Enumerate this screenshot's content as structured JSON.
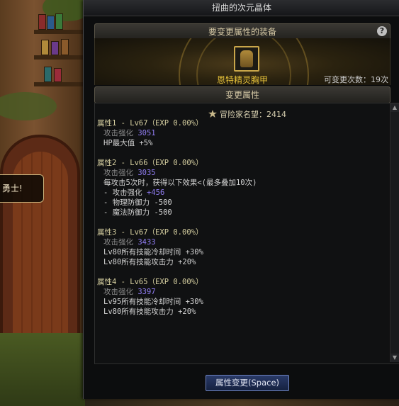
{
  "window": {
    "title": "扭曲的次元晶体"
  },
  "equipment_section": {
    "header": "要变更属性的装备",
    "item_name": "恩特精灵胸甲",
    "remaining_label": "可变更次数：19次"
  },
  "change_section": {
    "header": "变更属性"
  },
  "adventurer_fame": "冒险家名望：2414",
  "attributes": [
    {
      "heading": "属性1 - Lv67（EXP 0.00%）",
      "lines": [
        {
          "label": "攻击强化",
          "value": "3051"
        },
        {
          "text": "HP最大值 +5%"
        }
      ]
    },
    {
      "heading": "属性2 - Lv66（EXP 0.00%）",
      "lines": [
        {
          "label": "攻击强化",
          "value": "3035"
        },
        {
          "text": "每攻击5次时，获得以下效果<(最多叠加10次)"
        },
        {
          "label": "- 攻击强化",
          "value": "+456"
        },
        {
          "text": "- 物理防御力 -500"
        },
        {
          "text": "- 魔法防御力 -500"
        }
      ]
    },
    {
      "heading": "属性3 - Lv67（EXP 0.00%）",
      "lines": [
        {
          "label": "攻击强化",
          "value": "3433"
        },
        {
          "text": "Lv80所有技能冷却时间 +30%"
        },
        {
          "text": "Lv80所有技能攻击力 +20%"
        }
      ]
    },
    {
      "heading": "属性4 - Lv65（EXP 0.00%）",
      "lines": [
        {
          "label": "攻击强化",
          "value": "3397"
        },
        {
          "text": "Lv95所有技能冷却时间 +30%"
        },
        {
          "text": "Lv80所有技能攻击力 +20%"
        }
      ]
    }
  ],
  "change_button": "属性变更(Space)",
  "speech_bubble": "勇士!",
  "colors": {
    "accent_gold": "#e8c33a",
    "value_purple": "#8f7cf0",
    "button_blue": "#2a3a68"
  }
}
